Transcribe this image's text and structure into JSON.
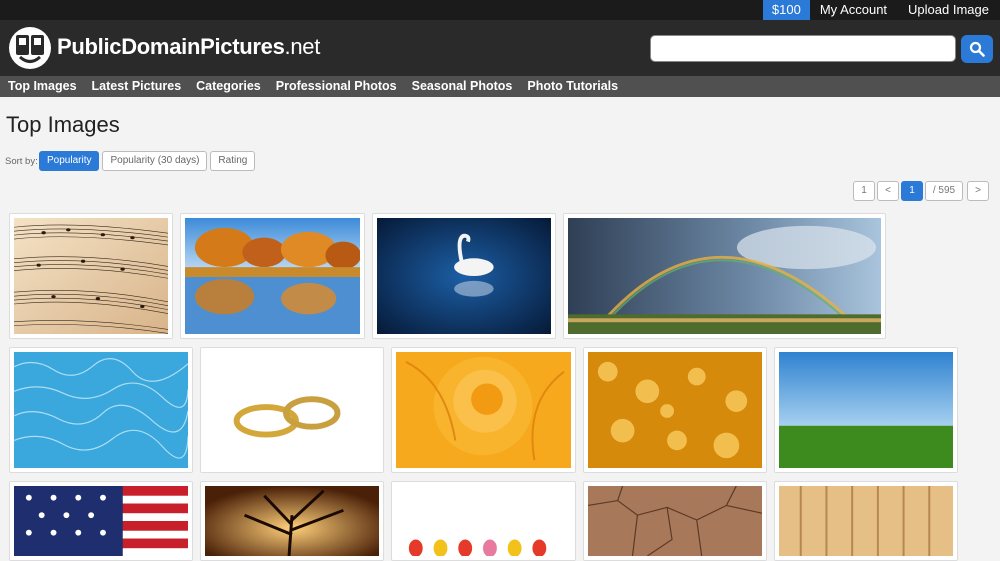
{
  "topbar": {
    "credit": "$100",
    "my_account": "My Account",
    "upload": "Upload Image"
  },
  "header": {
    "logo_bold": "PublicDomainPictures",
    "logo_suffix": ".net",
    "search_value": ""
  },
  "nav": {
    "items": [
      "Top Images",
      "Latest Pictures",
      "Categories",
      "Professional Photos",
      "Seasonal Photos",
      "Photo Tutorials"
    ]
  },
  "main": {
    "title": "Top Images",
    "sort_label": "Sort by:",
    "sort_options": [
      "Popularity",
      "Popularity (30 days)",
      "Rating"
    ],
    "sort_selected": "Popularity"
  },
  "pagination": {
    "first": "1",
    "prev": "<",
    "current": "1",
    "total": "/ 595",
    "next": ">"
  },
  "thumbnails": [
    {
      "subject": "sheet music"
    },
    {
      "subject": "autumn trees by lake"
    },
    {
      "subject": "white swan on blue water"
    },
    {
      "subject": "rainbow over fields"
    },
    {
      "subject": "pool water surface"
    },
    {
      "subject": "gold wedding rings"
    },
    {
      "subject": "orange rose"
    },
    {
      "subject": "golden bokeh"
    },
    {
      "subject": "green field blue sky"
    },
    {
      "subject": "american flag"
    },
    {
      "subject": "tree silhouette sunset"
    },
    {
      "subject": "tulips"
    },
    {
      "subject": "cracked dry earth"
    },
    {
      "subject": "wooden planks"
    }
  ],
  "colors": {
    "accent": "#2b7ad8",
    "topbar": "#1b1b1b",
    "header": "#2a2a2a",
    "nav": "#505050",
    "page_bg": "#f3f3f3"
  }
}
